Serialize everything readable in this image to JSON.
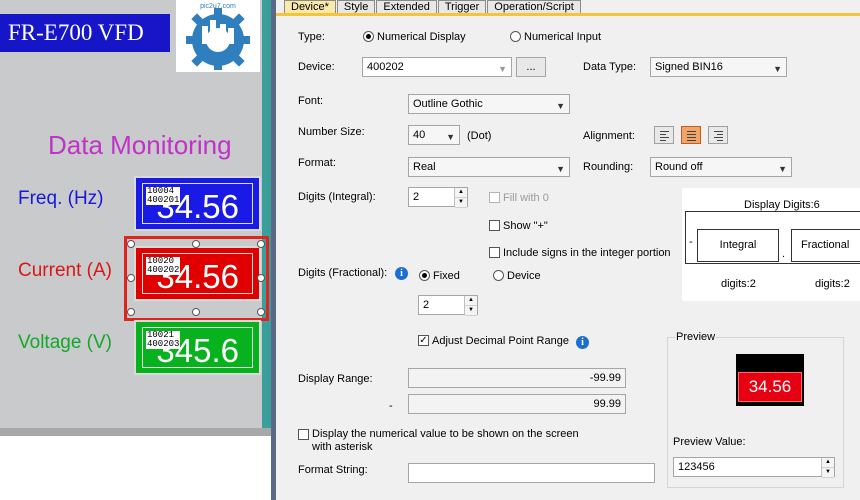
{
  "screen": {
    "title": "FR-E700 VFD",
    "heading": "Data Monitoring",
    "rows": [
      {
        "label": "Freq. (Hz)",
        "value": "34.56",
        "addr1": "10004",
        "addr2": "400201",
        "bg": "#1a1ae6",
        "label_color": "#1818d8"
      },
      {
        "label": "Current (A)",
        "value": "34.56",
        "addr1": "10020",
        "addr2": "400202",
        "bg": "#e00000",
        "label_color": "#d81818"
      },
      {
        "label": "Voltage (V)",
        "value": "345.6",
        "addr1": "10021",
        "addr2": "400203",
        "bg": "#08b21e",
        "label_color": "#12a828"
      }
    ],
    "watermark_text": "pic2u7.com"
  },
  "tabs": [
    "Device*",
    "Style",
    "Extended",
    "Trigger",
    "Operation/Script"
  ],
  "device_tab": {
    "type_label": "Type:",
    "type_numerical_display": "Numerical Display",
    "type_numerical_input": "Numerical Input",
    "device_label": "Device:",
    "device_value": "400202",
    "browse_label": "...",
    "data_type_label": "Data Type:",
    "data_type_value": "Signed BIN16",
    "font_label": "Font:",
    "font_value": "Outline Gothic",
    "number_size_label": "Number Size:",
    "number_size_value": "40",
    "dot_label": "(Dot)",
    "alignment_label": "Alignment:",
    "format_label": "Format:",
    "format_value": "Real",
    "rounding_label": "Rounding:",
    "rounding_value": "Round off",
    "digits_integral_label": "Digits (Integral):",
    "digits_integral_value": "2",
    "fill_with_0": "Fill with 0",
    "show_plus": "Show \"+\"",
    "include_signs": "Include signs in the integer portion",
    "digits_fractional_label": "Digits (Fractional):",
    "fixed_label": "Fixed",
    "device_option_label": "Device",
    "digits_fractional_value": "2",
    "adjust_decimal": "Adjust Decimal Point Range",
    "display_range_label": "Display Range:",
    "range_min": "-99.99",
    "range_dash": "-",
    "range_max": "99.99",
    "asterisk_label_line1": "Display the numerical value to be shown on the screen",
    "asterisk_label_line2": "with asterisk",
    "format_string_label": "Format String:",
    "format_string_value": ""
  },
  "display_digits": {
    "title": "Display Digits:6",
    "minus": "-",
    "integral": "Integral",
    "dot": ".",
    "fractional": "Fractional",
    "integral_digits": "digits:2",
    "fractional_digits": "digits:2"
  },
  "preview": {
    "group_label": "Preview",
    "value_shown": "34.56",
    "preview_value_label": "Preview Value:",
    "preview_value": "123456"
  },
  "colors": {
    "tab_active": "#fae9a8",
    "accent_tab_line": "#f4c43a",
    "selection": "#e3211d",
    "preview_red": "#e60012"
  },
  "icons": {
    "info": "info-icon",
    "dropdown": "chevron-down-icon",
    "spin": "spin-up-down-icon",
    "alignment": [
      "align-left-icon",
      "align-center-icon",
      "align-right-icon"
    ]
  }
}
